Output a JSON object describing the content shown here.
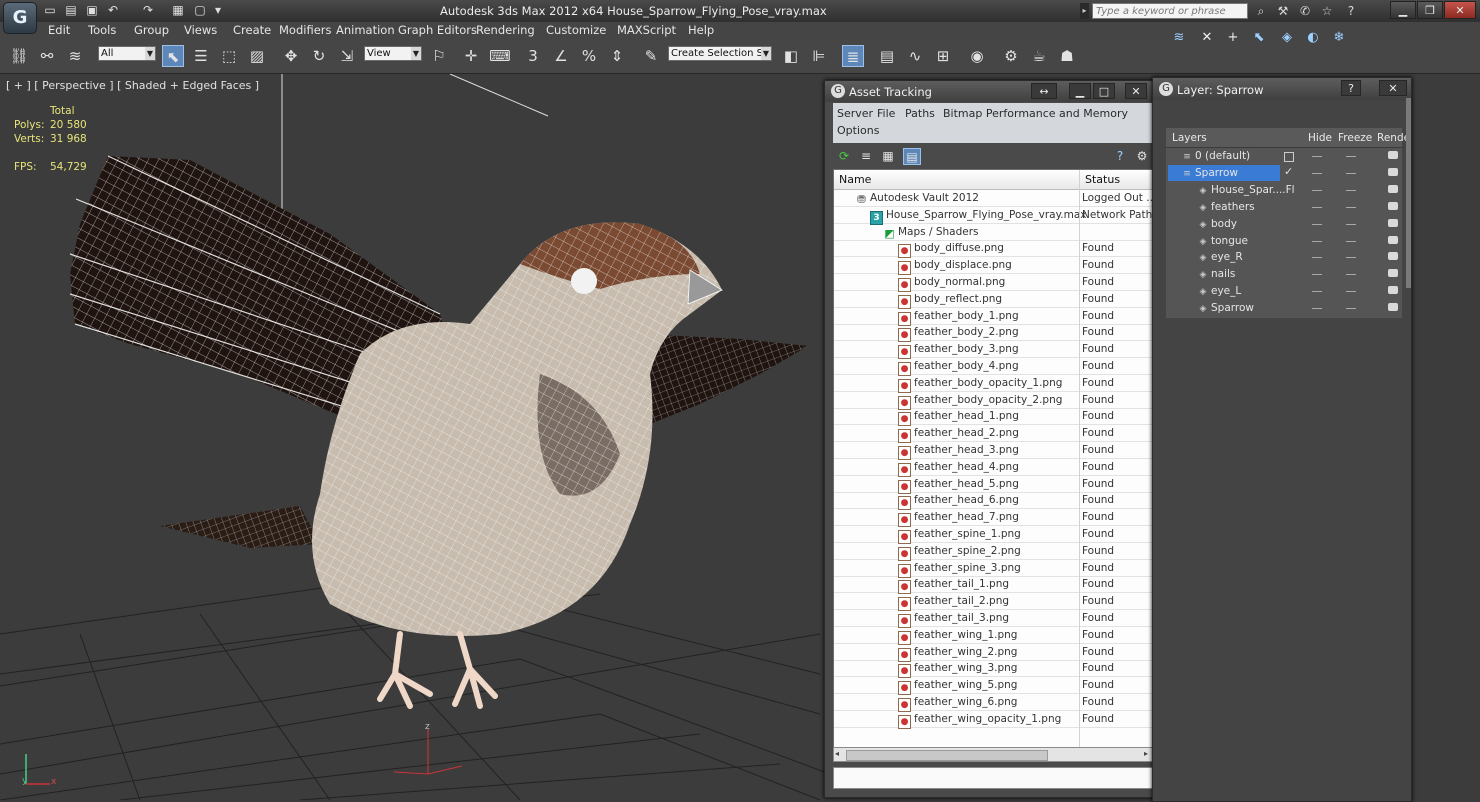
{
  "titlebar": {
    "app_name": "Autodesk 3ds Max  2012 x64",
    "file_name": "House_Sparrow_Flying_Pose_vray.max",
    "search_placeholder": "Type a keyword or phrase",
    "min_glyph": "▁",
    "restore_glyph": "❐",
    "close_glyph": "✕"
  },
  "menubar": [
    "Edit",
    "Tools",
    "Group",
    "Views",
    "Create",
    "Modifiers",
    "Animation",
    "Graph Editors",
    "Rendering",
    "Customize",
    "MAXScript",
    "Help"
  ],
  "toolbar": {
    "selection_filter": "All",
    "reference_coord": "View",
    "named_selection": "Create Selection Se",
    "snap_label": "3",
    "percent_label": "%"
  },
  "viewport": {
    "label": "[ + ] [ Perspective ] [ Shaded + Edged Faces ]",
    "stats_header": "Total",
    "polys_label": "Polys:",
    "polys_value": "20 580",
    "verts_label": "Verts:",
    "verts_value": "31 968",
    "fps_label": "FPS:",
    "fps_value": "54,729",
    "axis_x": "x",
    "axis_y": "y",
    "axis_z": "z"
  },
  "asset_tracking": {
    "title": "Asset Tracking",
    "menu": [
      "Server",
      "File",
      "Paths",
      "Bitmap Performance and Memory",
      "Options"
    ],
    "col_name": "Name",
    "col_status": "Status",
    "rows": [
      {
        "name": "Autodesk Vault 2012",
        "status": "Logged Out ...",
        "icon": "vault"
      },
      {
        "name": "House_Sparrow_Flying_Pose_vray.max",
        "status": "Network Path",
        "icon": "max"
      },
      {
        "name": "Maps / Shaders",
        "status": "",
        "icon": "maps"
      },
      {
        "name": "body_diffuse.png",
        "status": "Found",
        "icon": "file"
      },
      {
        "name": "body_displace.png",
        "status": "Found",
        "icon": "file"
      },
      {
        "name": "body_normal.png",
        "status": "Found",
        "icon": "file"
      },
      {
        "name": "body_reflect.png",
        "status": "Found",
        "icon": "file"
      },
      {
        "name": "feather_body_1.png",
        "status": "Found",
        "icon": "file"
      },
      {
        "name": "feather_body_2.png",
        "status": "Found",
        "icon": "file"
      },
      {
        "name": "feather_body_3.png",
        "status": "Found",
        "icon": "file"
      },
      {
        "name": "feather_body_4.png",
        "status": "Found",
        "icon": "file"
      },
      {
        "name": "feather_body_opacity_1.png",
        "status": "Found",
        "icon": "file"
      },
      {
        "name": "feather_body_opacity_2.png",
        "status": "Found",
        "icon": "file"
      },
      {
        "name": "feather_head_1.png",
        "status": "Found",
        "icon": "file"
      },
      {
        "name": "feather_head_2.png",
        "status": "Found",
        "icon": "file"
      },
      {
        "name": "feather_head_3.png",
        "status": "Found",
        "icon": "file"
      },
      {
        "name": "feather_head_4.png",
        "status": "Found",
        "icon": "file"
      },
      {
        "name": "feather_head_5.png",
        "status": "Found",
        "icon": "file"
      },
      {
        "name": "feather_head_6.png",
        "status": "Found",
        "icon": "file"
      },
      {
        "name": "feather_head_7.png",
        "status": "Found",
        "icon": "file"
      },
      {
        "name": "feather_spine_1.png",
        "status": "Found",
        "icon": "file"
      },
      {
        "name": "feather_spine_2.png",
        "status": "Found",
        "icon": "file"
      },
      {
        "name": "feather_spine_3.png",
        "status": "Found",
        "icon": "file"
      },
      {
        "name": "feather_tail_1.png",
        "status": "Found",
        "icon": "file"
      },
      {
        "name": "feather_tail_2.png",
        "status": "Found",
        "icon": "file"
      },
      {
        "name": "feather_tail_3.png",
        "status": "Found",
        "icon": "file"
      },
      {
        "name": "feather_wing_1.png",
        "status": "Found",
        "icon": "file"
      },
      {
        "name": "feather_wing_2.png",
        "status": "Found",
        "icon": "file"
      },
      {
        "name": "feather_wing_3.png",
        "status": "Found",
        "icon": "file"
      },
      {
        "name": "feather_wing_5.png",
        "status": "Found",
        "icon": "file"
      },
      {
        "name": "feather_wing_6.png",
        "status": "Found",
        "icon": "file"
      },
      {
        "name": "feather_wing_opacity_1.png",
        "status": "Found",
        "icon": "file"
      }
    ]
  },
  "layer_window": {
    "title": "Layer: Sparrow",
    "help_glyph": "?",
    "col_layers": "Layers",
    "col_hide": "Hide",
    "col_freeze": "Freeze",
    "col_render": "Rende",
    "rows": [
      {
        "name": "0 (default)",
        "level": 0
      },
      {
        "name": "Sparrow",
        "level": 0,
        "selected": true
      },
      {
        "name": "House_Spar....Fl",
        "level": 1
      },
      {
        "name": "feathers",
        "level": 1
      },
      {
        "name": "body",
        "level": 1
      },
      {
        "name": "tongue",
        "level": 1
      },
      {
        "name": "eye_R",
        "level": 1
      },
      {
        "name": "nails",
        "level": 1
      },
      {
        "name": "eye_L",
        "level": 1
      },
      {
        "name": "Sparrow",
        "level": 1
      }
    ]
  },
  "colors": {
    "selection": "#3a7bd5",
    "stat_text": "#e8e47a",
    "viewport_bg": "#3c3c3c",
    "ui_bg": "#464646"
  }
}
